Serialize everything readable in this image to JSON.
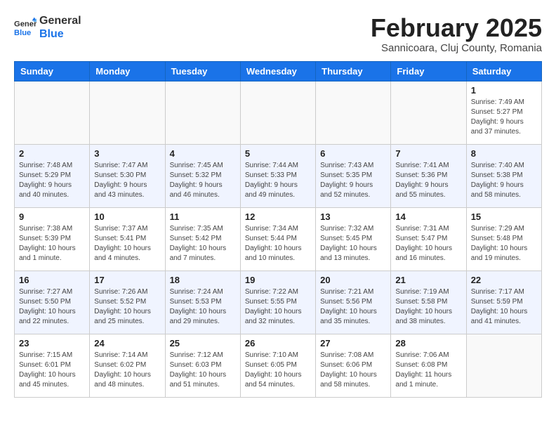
{
  "header": {
    "logo_line1": "General",
    "logo_line2": "Blue",
    "month_title": "February 2025",
    "subtitle": "Sannicoara, Cluj County, Romania"
  },
  "days_of_week": [
    "Sunday",
    "Monday",
    "Tuesday",
    "Wednesday",
    "Thursday",
    "Friday",
    "Saturday"
  ],
  "weeks": [
    [
      {
        "day": "",
        "info": ""
      },
      {
        "day": "",
        "info": ""
      },
      {
        "day": "",
        "info": ""
      },
      {
        "day": "",
        "info": ""
      },
      {
        "day": "",
        "info": ""
      },
      {
        "day": "",
        "info": ""
      },
      {
        "day": "1",
        "info": "Sunrise: 7:49 AM\nSunset: 5:27 PM\nDaylight: 9 hours\nand 37 minutes."
      }
    ],
    [
      {
        "day": "2",
        "info": "Sunrise: 7:48 AM\nSunset: 5:29 PM\nDaylight: 9 hours\nand 40 minutes."
      },
      {
        "day": "3",
        "info": "Sunrise: 7:47 AM\nSunset: 5:30 PM\nDaylight: 9 hours\nand 43 minutes."
      },
      {
        "day": "4",
        "info": "Sunrise: 7:45 AM\nSunset: 5:32 PM\nDaylight: 9 hours\nand 46 minutes."
      },
      {
        "day": "5",
        "info": "Sunrise: 7:44 AM\nSunset: 5:33 PM\nDaylight: 9 hours\nand 49 minutes."
      },
      {
        "day": "6",
        "info": "Sunrise: 7:43 AM\nSunset: 5:35 PM\nDaylight: 9 hours\nand 52 minutes."
      },
      {
        "day": "7",
        "info": "Sunrise: 7:41 AM\nSunset: 5:36 PM\nDaylight: 9 hours\nand 55 minutes."
      },
      {
        "day": "8",
        "info": "Sunrise: 7:40 AM\nSunset: 5:38 PM\nDaylight: 9 hours\nand 58 minutes."
      }
    ],
    [
      {
        "day": "9",
        "info": "Sunrise: 7:38 AM\nSunset: 5:39 PM\nDaylight: 10 hours\nand 1 minute."
      },
      {
        "day": "10",
        "info": "Sunrise: 7:37 AM\nSunset: 5:41 PM\nDaylight: 10 hours\nand 4 minutes."
      },
      {
        "day": "11",
        "info": "Sunrise: 7:35 AM\nSunset: 5:42 PM\nDaylight: 10 hours\nand 7 minutes."
      },
      {
        "day": "12",
        "info": "Sunrise: 7:34 AM\nSunset: 5:44 PM\nDaylight: 10 hours\nand 10 minutes."
      },
      {
        "day": "13",
        "info": "Sunrise: 7:32 AM\nSunset: 5:45 PM\nDaylight: 10 hours\nand 13 minutes."
      },
      {
        "day": "14",
        "info": "Sunrise: 7:31 AM\nSunset: 5:47 PM\nDaylight: 10 hours\nand 16 minutes."
      },
      {
        "day": "15",
        "info": "Sunrise: 7:29 AM\nSunset: 5:48 PM\nDaylight: 10 hours\nand 19 minutes."
      }
    ],
    [
      {
        "day": "16",
        "info": "Sunrise: 7:27 AM\nSunset: 5:50 PM\nDaylight: 10 hours\nand 22 minutes."
      },
      {
        "day": "17",
        "info": "Sunrise: 7:26 AM\nSunset: 5:52 PM\nDaylight: 10 hours\nand 25 minutes."
      },
      {
        "day": "18",
        "info": "Sunrise: 7:24 AM\nSunset: 5:53 PM\nDaylight: 10 hours\nand 29 minutes."
      },
      {
        "day": "19",
        "info": "Sunrise: 7:22 AM\nSunset: 5:55 PM\nDaylight: 10 hours\nand 32 minutes."
      },
      {
        "day": "20",
        "info": "Sunrise: 7:21 AM\nSunset: 5:56 PM\nDaylight: 10 hours\nand 35 minutes."
      },
      {
        "day": "21",
        "info": "Sunrise: 7:19 AM\nSunset: 5:58 PM\nDaylight: 10 hours\nand 38 minutes."
      },
      {
        "day": "22",
        "info": "Sunrise: 7:17 AM\nSunset: 5:59 PM\nDaylight: 10 hours\nand 41 minutes."
      }
    ],
    [
      {
        "day": "23",
        "info": "Sunrise: 7:15 AM\nSunset: 6:01 PM\nDaylight: 10 hours\nand 45 minutes."
      },
      {
        "day": "24",
        "info": "Sunrise: 7:14 AM\nSunset: 6:02 PM\nDaylight: 10 hours\nand 48 minutes."
      },
      {
        "day": "25",
        "info": "Sunrise: 7:12 AM\nSunset: 6:03 PM\nDaylight: 10 hours\nand 51 minutes."
      },
      {
        "day": "26",
        "info": "Sunrise: 7:10 AM\nSunset: 6:05 PM\nDaylight: 10 hours\nand 54 minutes."
      },
      {
        "day": "27",
        "info": "Sunrise: 7:08 AM\nSunset: 6:06 PM\nDaylight: 10 hours\nand 58 minutes."
      },
      {
        "day": "28",
        "info": "Sunrise: 7:06 AM\nSunset: 6:08 PM\nDaylight: 11 hours\nand 1 minute."
      },
      {
        "day": "",
        "info": ""
      }
    ]
  ]
}
